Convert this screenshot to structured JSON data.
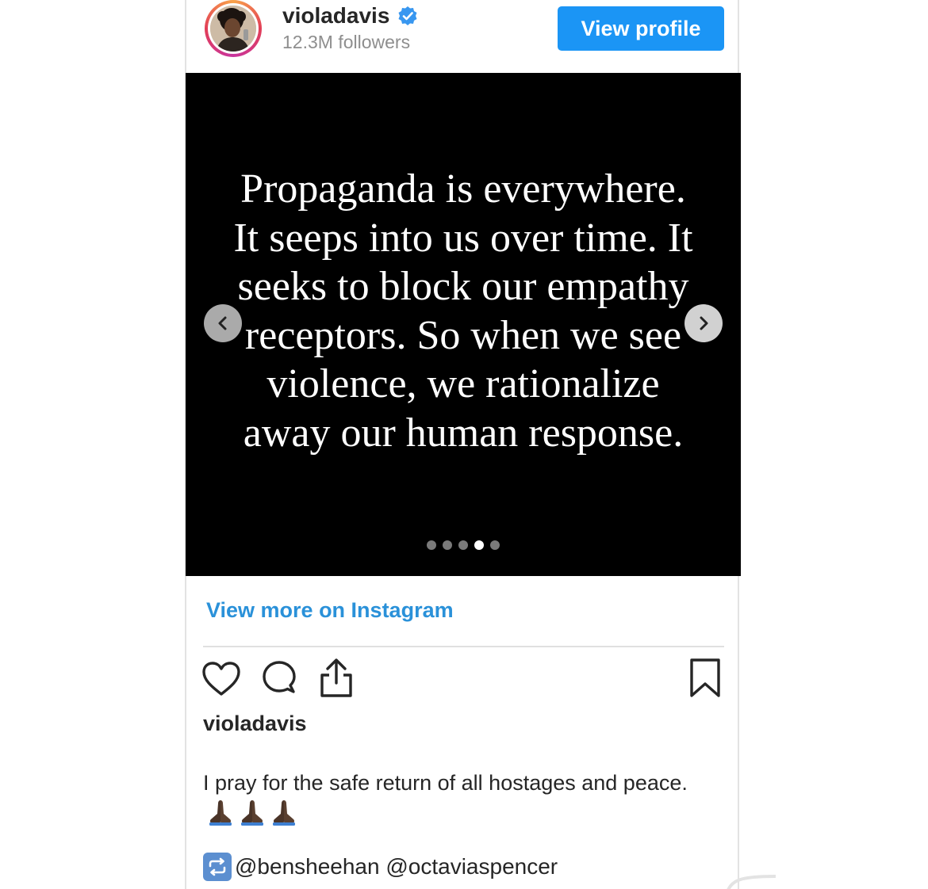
{
  "header": {
    "username": "violadavis",
    "followers": "12.3M followers",
    "view_profile_label": "View profile"
  },
  "post": {
    "quote_lines": "Propaganda is everywhere.\nIt seeps into us over time. It\nseeks to block our empathy\nreceptors. So when we see\nviolence, we rationalize\naway our human response.",
    "carousel_total": 5,
    "carousel_active_index": 4
  },
  "links": {
    "view_more": "View more on Instagram"
  },
  "caption": {
    "username": "violadavis",
    "text": "I pray for the safe return of all hostages and peace.",
    "emoji_count": 3,
    "mentions": "@bensheehan @octaviaspencer"
  },
  "colors": {
    "button_blue": "#1b95f5",
    "link_blue": "#2a91d9",
    "verified_blue": "#3897f0",
    "media_background": "#000000"
  },
  "icons": {
    "verified": "verified-badge-icon",
    "prev": "chevron-left-icon",
    "next": "chevron-right-icon",
    "like": "heart-icon",
    "comment": "comment-bubble-icon",
    "share": "share-upload-icon",
    "save": "bookmark-icon",
    "repost": "repeat-icon",
    "emoji": "folded-hands-emoji"
  }
}
